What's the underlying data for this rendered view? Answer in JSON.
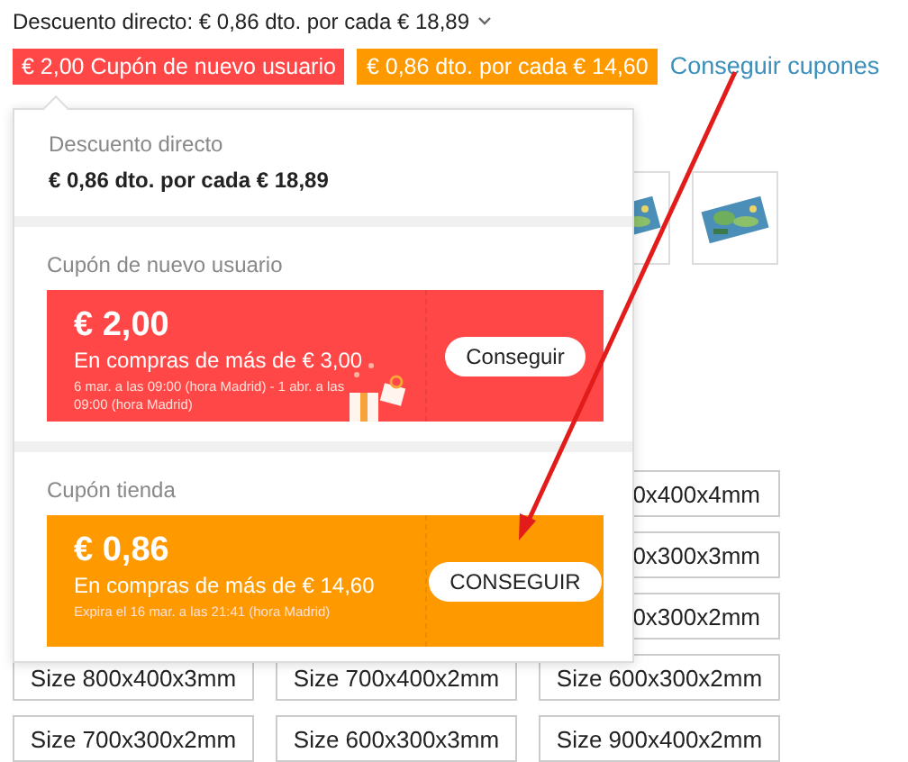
{
  "summary": {
    "text": "Descuento directo: € 0,86 dto. por cada € 18,89",
    "expandable": true
  },
  "badges": [
    {
      "text": "€ 2,00 Cupón de nuevo usuario",
      "color": "#ff4747"
    },
    {
      "text": "€ 0,86 dto. por cada € 14,60",
      "color": "#ff9900"
    }
  ],
  "link": "Conseguir cupones",
  "size_options": [
    {
      "text": "0x400x4mm",
      "partial": true
    },
    {
      "text": "0x300x3mm",
      "partial": true
    },
    {
      "text": "0x300x2mm",
      "partial": true
    },
    {
      "text": "Size 800x400x3mm",
      "partial": false
    },
    {
      "text": "Size 700x400x2mm",
      "partial": false
    },
    {
      "text": "Size 600x300x2mm",
      "partial": false
    },
    {
      "text": "Size 700x300x2mm",
      "partial": false
    },
    {
      "text": "Size 600x300x3mm",
      "partial": false
    },
    {
      "text": "Size 900x400x2mm",
      "partial": false
    }
  ],
  "popup": {
    "direct": {
      "title": "Descuento directo",
      "text": "€ 0,86 dto. por cada € 18,89"
    },
    "coupons": [
      {
        "title": "Cupón de nuevo usuario",
        "amount": "€ 2,00",
        "condition": "En compras de más de € 3,00",
        "validity": "6 mar. a las 09:00 (hora Madrid) - 1 abr. a las 09:00 (hora Madrid)",
        "button": "Conseguir",
        "color": "#ff4747",
        "gift": true
      },
      {
        "title": "Cupón tienda",
        "amount": "€ 0,86",
        "condition": "En compras de más de € 14,60",
        "validity": "Expira el 16 mar. a las 21:41 (hora Madrid)",
        "button": "CONSEGUIR",
        "color": "#ff9900",
        "gift": false
      }
    ]
  }
}
